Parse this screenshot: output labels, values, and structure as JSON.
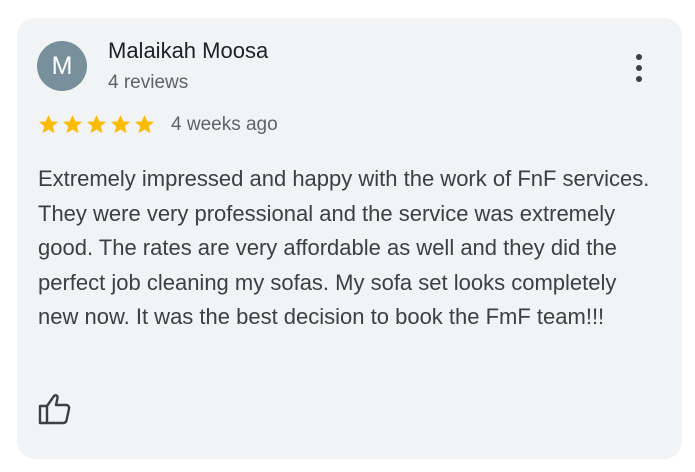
{
  "review": {
    "avatar_initial": "M",
    "avatar_color": "#78909c",
    "author_name": "Malaikah Moosa",
    "review_count": "4 reviews",
    "rating": 5,
    "rating_max": 5,
    "star_color": "#fbbc04",
    "time_ago": "4 weeks ago",
    "text": "Extremely impressed and happy with the work of FnF services. They were very professional and the service was extremely good. The rates are very affordable as well and they did the perfect job cleaning my sofas. My sofa set looks completely new now. It was the best decision to book the FmF team!!!"
  },
  "icons": {
    "menu": "more-vert-icon",
    "like": "thumbs-up-icon",
    "star": "star-icon"
  }
}
